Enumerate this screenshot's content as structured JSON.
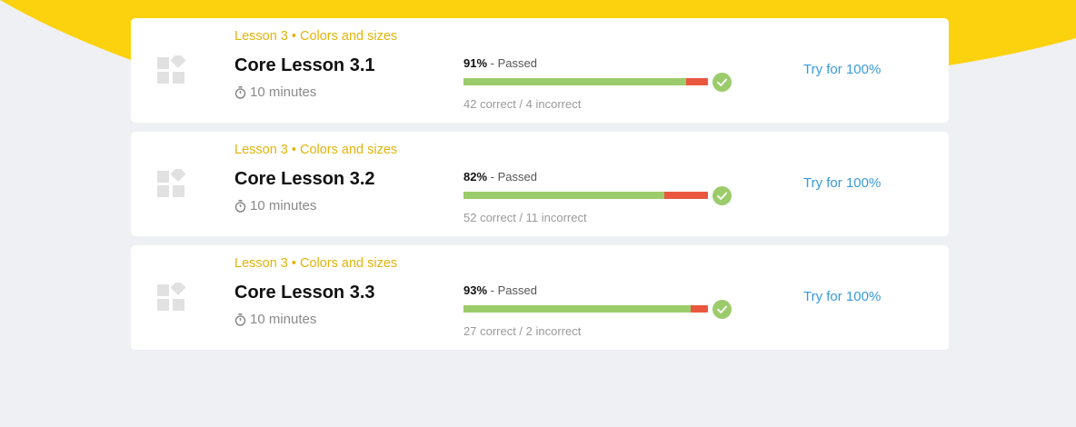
{
  "theme": {
    "accent": "#fcd20f",
    "link": "#3a9ad9",
    "pass": "#9ccb6b",
    "fail": "#e9573f"
  },
  "lessons": [
    {
      "course": "Lesson 3 • Colors and sizes",
      "title": "Core Lesson 3.1",
      "duration": "10 minutes",
      "score": "91%",
      "status": " - Passed",
      "progress": 0.91,
      "counts": "42 correct / 4 incorrect",
      "action": "Try for 100%",
      "icon": "lesson-blocks-icon"
    },
    {
      "course": "Lesson 3 • Colors and sizes",
      "title": "Core Lesson 3.2",
      "duration": "10 minutes",
      "score": "82%",
      "status": " - Passed",
      "progress": 0.82,
      "counts": "52 correct / 11 incorrect",
      "action": "Try for 100%",
      "icon": "lesson-blocks-icon"
    },
    {
      "course": "Lesson 3 • Colors and sizes",
      "title": "Core Lesson 3.3",
      "duration": "10 minutes",
      "score": "93%",
      "status": " - Passed",
      "progress": 0.93,
      "counts": "27 correct / 2 incorrect",
      "action": "Try for 100%",
      "icon": "lesson-blocks-icon"
    }
  ]
}
